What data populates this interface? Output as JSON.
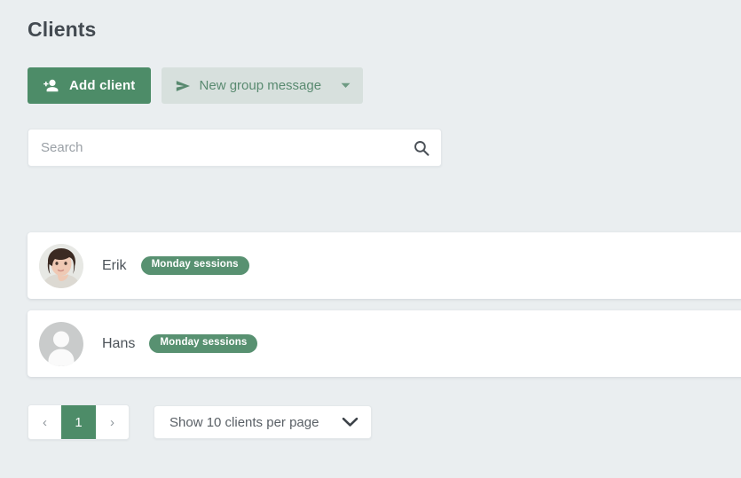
{
  "page": {
    "title": "Clients",
    "background_color": "#eaeef0"
  },
  "theme": {
    "accent_green": "#4d8c68",
    "badge_green": "#589171",
    "secondary_button_bg": "#d7e0dd",
    "secondary_button_text": "#598a70",
    "text_dark": "#434a51"
  },
  "toolbar": {
    "add_client_label": "Add client",
    "add_client_icon": "person-add-icon",
    "new_group_message_label": "New group message",
    "new_group_message_icon": "send-icon",
    "new_group_message_caret_icon": "caret-down-icon"
  },
  "search": {
    "value": "",
    "placeholder": "Search",
    "icon": "search-icon"
  },
  "clients": [
    {
      "name": "Erik",
      "badge": "Monday sessions",
      "avatar_type": "photo-avatar"
    },
    {
      "name": "Hans",
      "badge": "Monday sessions",
      "avatar_type": "placeholder-avatar"
    }
  ],
  "pagination": {
    "prev_label": "‹",
    "next_label": "›",
    "pages": [
      "1"
    ],
    "current_page": "1"
  },
  "per_page": {
    "label": "Show 10 clients per page",
    "caret_icon": "chevron-down-icon"
  }
}
